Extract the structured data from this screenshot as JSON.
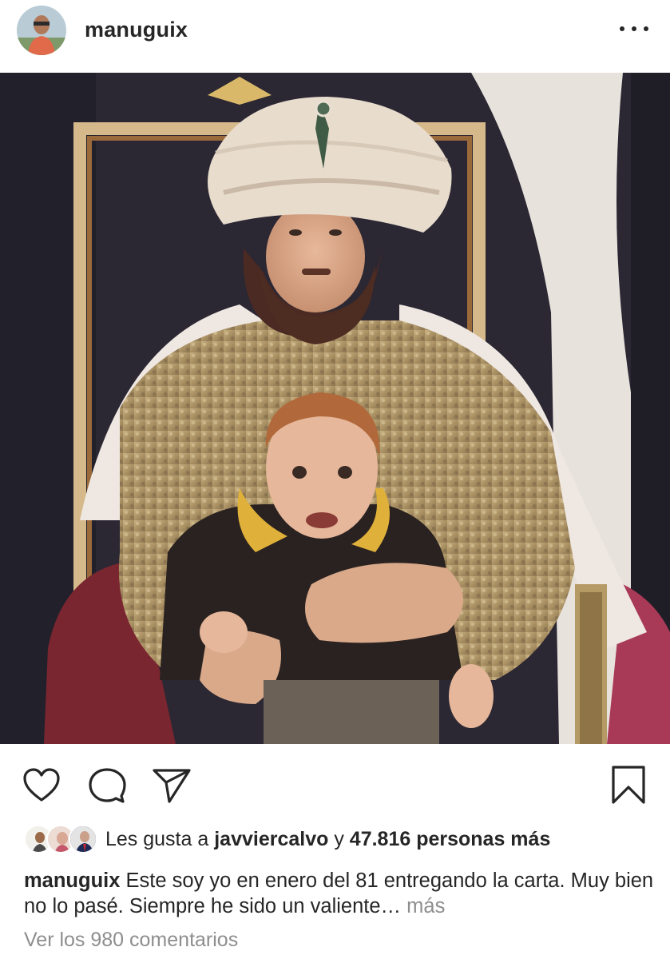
{
  "post": {
    "username": "manuguix",
    "more_icon": "more-horizontal-icon"
  },
  "actions": {
    "like_icon": "heart-icon",
    "comment_icon": "comment-icon",
    "share_icon": "send-icon",
    "save_icon": "bookmark-icon"
  },
  "likes": {
    "prefix": "Les gusta a",
    "user": "javviercalvo",
    "connector": "y",
    "count_text": "47.816 personas más"
  },
  "caption": {
    "username": "manuguix",
    "text": "Este soy yo en enero del 81 entregando la carta. Muy bien no lo pasé. Siempre he sido un valiente…",
    "more": "más"
  },
  "comments": {
    "view_all": "Ver los 980 comentarios"
  }
}
